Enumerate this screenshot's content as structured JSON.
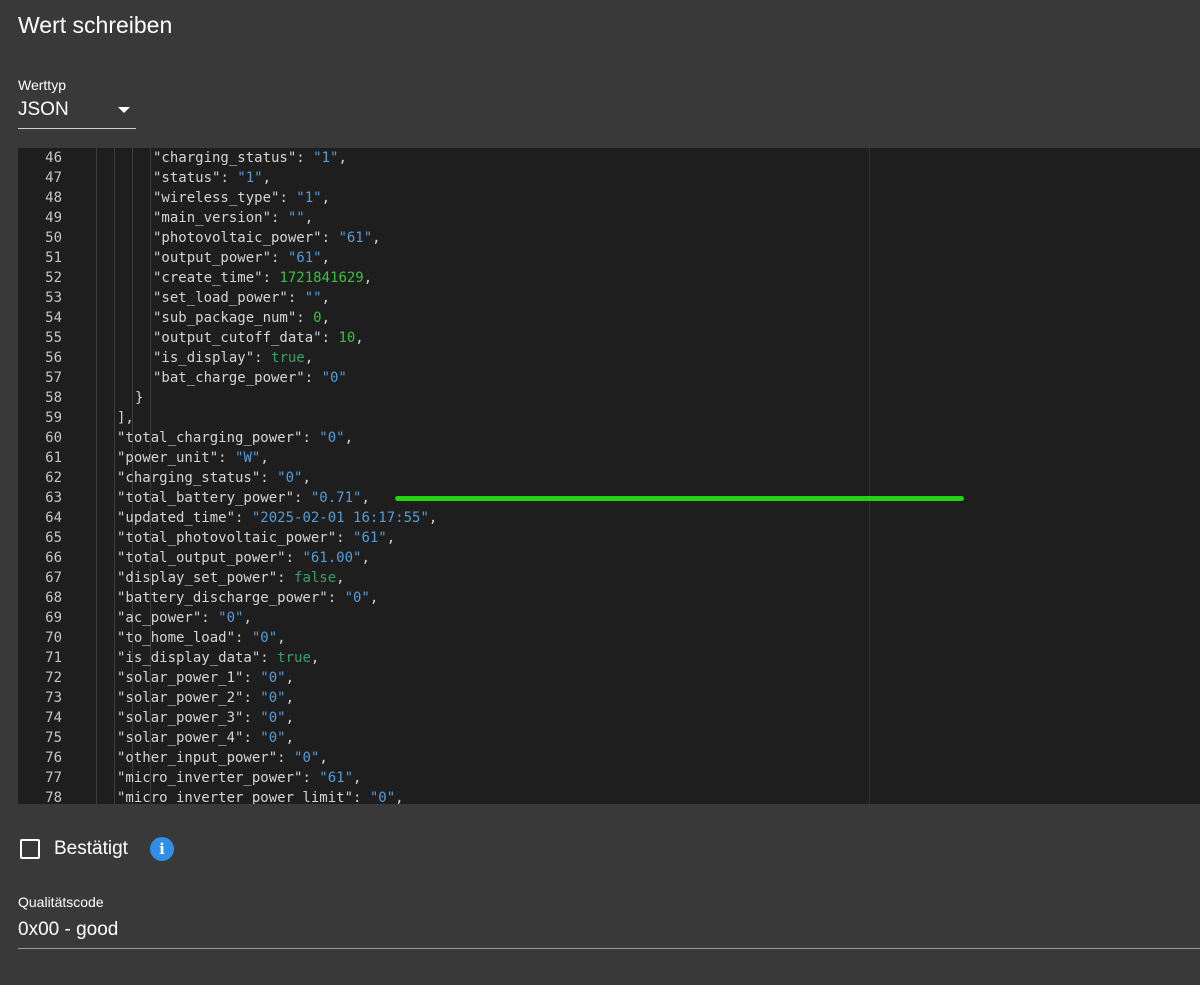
{
  "dialog": {
    "title": "Wert schreiben"
  },
  "value_type": {
    "label": "Werttyp",
    "selected": "JSON"
  },
  "editor": {
    "lines": [
      {
        "n": "46",
        "indent": 3,
        "tokens": [
          [
            "key",
            "\"charging_status\""
          ],
          [
            "punc",
            ": "
          ],
          [
            "str",
            "\"1\""
          ],
          [
            "punc",
            ","
          ]
        ]
      },
      {
        "n": "47",
        "indent": 3,
        "tokens": [
          [
            "key",
            "\"status\""
          ],
          [
            "punc",
            ": "
          ],
          [
            "str",
            "\"1\""
          ],
          [
            "punc",
            ","
          ]
        ]
      },
      {
        "n": "48",
        "indent": 3,
        "tokens": [
          [
            "key",
            "\"wireless_type\""
          ],
          [
            "punc",
            ": "
          ],
          [
            "str",
            "\"1\""
          ],
          [
            "punc",
            ","
          ]
        ]
      },
      {
        "n": "49",
        "indent": 3,
        "tokens": [
          [
            "key",
            "\"main_version\""
          ],
          [
            "punc",
            ": "
          ],
          [
            "str",
            "\"\""
          ],
          [
            "punc",
            ","
          ]
        ]
      },
      {
        "n": "50",
        "indent": 3,
        "tokens": [
          [
            "key",
            "\"photovoltaic_power\""
          ],
          [
            "punc",
            ": "
          ],
          [
            "str",
            "\"61\""
          ],
          [
            "punc",
            ","
          ]
        ]
      },
      {
        "n": "51",
        "indent": 3,
        "tokens": [
          [
            "key",
            "\"output_power\""
          ],
          [
            "punc",
            ": "
          ],
          [
            "str",
            "\"61\""
          ],
          [
            "punc",
            ","
          ]
        ]
      },
      {
        "n": "52",
        "indent": 3,
        "tokens": [
          [
            "key",
            "\"create_time\""
          ],
          [
            "punc",
            ": "
          ],
          [
            "num",
            "1721841629"
          ],
          [
            "punc",
            ","
          ]
        ]
      },
      {
        "n": "53",
        "indent": 3,
        "tokens": [
          [
            "key",
            "\"set_load_power\""
          ],
          [
            "punc",
            ": "
          ],
          [
            "str",
            "\"\""
          ],
          [
            "punc",
            ","
          ]
        ]
      },
      {
        "n": "54",
        "indent": 3,
        "tokens": [
          [
            "key",
            "\"sub_package_num\""
          ],
          [
            "punc",
            ": "
          ],
          [
            "num",
            "0"
          ],
          [
            "punc",
            ","
          ]
        ]
      },
      {
        "n": "55",
        "indent": 3,
        "tokens": [
          [
            "key",
            "\"output_cutoff_data\""
          ],
          [
            "punc",
            ": "
          ],
          [
            "num",
            "10"
          ],
          [
            "punc",
            ","
          ]
        ]
      },
      {
        "n": "56",
        "indent": 3,
        "tokens": [
          [
            "key",
            "\"is_display\""
          ],
          [
            "punc",
            ": "
          ],
          [
            "bool",
            "true"
          ],
          [
            "punc",
            ","
          ]
        ]
      },
      {
        "n": "57",
        "indent": 3,
        "tokens": [
          [
            "key",
            "\"bat_charge_power\""
          ],
          [
            "punc",
            ": "
          ],
          [
            "str",
            "\"0\""
          ]
        ]
      },
      {
        "n": "58",
        "indent": 2,
        "tokens": [
          [
            "punc",
            "}"
          ]
        ]
      },
      {
        "n": "59",
        "indent": 1,
        "tokens": [
          [
            "punc",
            "],"
          ]
        ]
      },
      {
        "n": "60",
        "indent": 1,
        "tokens": [
          [
            "key",
            "\"total_charging_power\""
          ],
          [
            "punc",
            ": "
          ],
          [
            "str",
            "\"0\""
          ],
          [
            "punc",
            ","
          ]
        ]
      },
      {
        "n": "61",
        "indent": 1,
        "tokens": [
          [
            "key",
            "\"power_unit\""
          ],
          [
            "punc",
            ": "
          ],
          [
            "str",
            "\"W\""
          ],
          [
            "punc",
            ","
          ]
        ]
      },
      {
        "n": "62",
        "indent": 1,
        "tokens": [
          [
            "key",
            "\"charging_status\""
          ],
          [
            "punc",
            ": "
          ],
          [
            "str",
            "\"0\""
          ],
          [
            "punc",
            ","
          ]
        ]
      },
      {
        "n": "63",
        "indent": 1,
        "tokens": [
          [
            "key",
            "\"total_battery_power\""
          ],
          [
            "punc",
            ": "
          ],
          [
            "str",
            "\"0.71\""
          ],
          [
            "punc",
            ","
          ]
        ]
      },
      {
        "n": "64",
        "indent": 1,
        "tokens": [
          [
            "key",
            "\"updated_time\""
          ],
          [
            "punc",
            ": "
          ],
          [
            "str",
            "\"2025-02-01 16:17:55\""
          ],
          [
            "punc",
            ","
          ]
        ]
      },
      {
        "n": "65",
        "indent": 1,
        "tokens": [
          [
            "key",
            "\"total_photovoltaic_power\""
          ],
          [
            "punc",
            ": "
          ],
          [
            "str",
            "\"61\""
          ],
          [
            "punc",
            ","
          ]
        ]
      },
      {
        "n": "66",
        "indent": 1,
        "tokens": [
          [
            "key",
            "\"total_output_power\""
          ],
          [
            "punc",
            ": "
          ],
          [
            "str",
            "\"61.00\""
          ],
          [
            "punc",
            ","
          ]
        ]
      },
      {
        "n": "67",
        "indent": 1,
        "tokens": [
          [
            "key",
            "\"display_set_power\""
          ],
          [
            "punc",
            ": "
          ],
          [
            "bool",
            "false"
          ],
          [
            "punc",
            ","
          ]
        ]
      },
      {
        "n": "68",
        "indent": 1,
        "tokens": [
          [
            "key",
            "\"battery_discharge_power\""
          ],
          [
            "punc",
            ": "
          ],
          [
            "str",
            "\"0\""
          ],
          [
            "punc",
            ","
          ]
        ]
      },
      {
        "n": "69",
        "indent": 1,
        "tokens": [
          [
            "key",
            "\"ac_power\""
          ],
          [
            "punc",
            ": "
          ],
          [
            "str",
            "\"0\""
          ],
          [
            "punc",
            ","
          ]
        ]
      },
      {
        "n": "70",
        "indent": 1,
        "tokens": [
          [
            "key",
            "\"to_home_load\""
          ],
          [
            "punc",
            ": "
          ],
          [
            "str",
            "\"0\""
          ],
          [
            "punc",
            ","
          ]
        ]
      },
      {
        "n": "71",
        "indent": 1,
        "tokens": [
          [
            "key",
            "\"is_display_data\""
          ],
          [
            "punc",
            ": "
          ],
          [
            "bool",
            "true"
          ],
          [
            "punc",
            ","
          ]
        ]
      },
      {
        "n": "72",
        "indent": 1,
        "tokens": [
          [
            "key",
            "\"solar_power_1\""
          ],
          [
            "punc",
            ": "
          ],
          [
            "str",
            "\"0\""
          ],
          [
            "punc",
            ","
          ]
        ]
      },
      {
        "n": "73",
        "indent": 1,
        "tokens": [
          [
            "key",
            "\"solar_power_2\""
          ],
          [
            "punc",
            ": "
          ],
          [
            "str",
            "\"0\""
          ],
          [
            "punc",
            ","
          ]
        ]
      },
      {
        "n": "74",
        "indent": 1,
        "tokens": [
          [
            "key",
            "\"solar_power_3\""
          ],
          [
            "punc",
            ": "
          ],
          [
            "str",
            "\"0\""
          ],
          [
            "punc",
            ","
          ]
        ]
      },
      {
        "n": "75",
        "indent": 1,
        "tokens": [
          [
            "key",
            "\"solar_power_4\""
          ],
          [
            "punc",
            ": "
          ],
          [
            "str",
            "\"0\""
          ],
          [
            "punc",
            ","
          ]
        ]
      },
      {
        "n": "76",
        "indent": 1,
        "tokens": [
          [
            "key",
            "\"other_input_power\""
          ],
          [
            "punc",
            ": "
          ],
          [
            "str",
            "\"0\""
          ],
          [
            "punc",
            ","
          ]
        ]
      },
      {
        "n": "77",
        "indent": 1,
        "tokens": [
          [
            "key",
            "\"micro_inverter_power\""
          ],
          [
            "punc",
            ": "
          ],
          [
            "str",
            "\"61\""
          ],
          [
            "punc",
            ","
          ]
        ]
      },
      {
        "n": "78",
        "indent": 1,
        "tokens": [
          [
            "key",
            "\"micro_inverter_power_limit\""
          ],
          [
            "punc",
            ": "
          ],
          [
            "str",
            "\"0\""
          ],
          [
            "punc",
            ","
          ]
        ]
      }
    ]
  },
  "confirm": {
    "label": "Bestätigt",
    "checked": false,
    "icon": "info-icon"
  },
  "quality": {
    "label": "Qualitätscode",
    "value": "0x00 - good"
  },
  "colors": {
    "background": "#393939",
    "editor_background": "#1e1e1e",
    "string": "#569cd6",
    "number": "#3fbf3f",
    "boolean": "#3a9f6a",
    "highlight_bar": "#22d30f",
    "info_icon": "#2f8fe8"
  }
}
